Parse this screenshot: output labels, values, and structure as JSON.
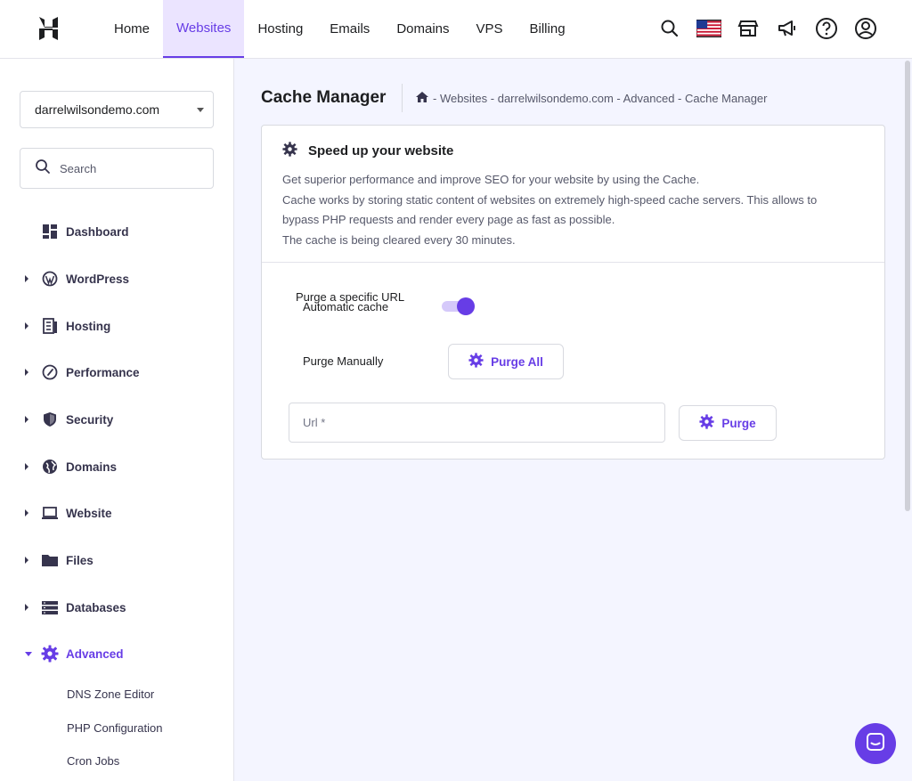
{
  "topbar": {
    "logo_icon": "hostinger-logo-icon",
    "nav": [
      {
        "label": "Home",
        "active": false
      },
      {
        "label": "Websites",
        "active": true
      },
      {
        "label": "Hosting",
        "active": false
      },
      {
        "label": "Emails",
        "active": false
      },
      {
        "label": "Domains",
        "active": false
      },
      {
        "label": "VPS",
        "active": false
      },
      {
        "label": "Billing",
        "active": false
      }
    ],
    "icons": [
      "search-icon",
      "us-flag-icon",
      "store-icon",
      "megaphone-icon",
      "help-icon",
      "account-icon"
    ]
  },
  "sidebar": {
    "domain_selected": "darrelwilsondemo.com",
    "search_placeholder": "Search",
    "items": [
      {
        "label": "Dashboard",
        "icon": "dashboard-icon",
        "expandable": false
      },
      {
        "label": "WordPress",
        "icon": "wordpress-icon",
        "expandable": true
      },
      {
        "label": "Hosting",
        "icon": "hosting-icon",
        "expandable": true
      },
      {
        "label": "Performance",
        "icon": "performance-icon",
        "expandable": true
      },
      {
        "label": "Security",
        "icon": "shield-icon",
        "expandable": true
      },
      {
        "label": "Domains",
        "icon": "globe-icon",
        "expandable": true
      },
      {
        "label": "Website",
        "icon": "laptop-icon",
        "expandable": true
      },
      {
        "label": "Files",
        "icon": "folder-icon",
        "expandable": true
      },
      {
        "label": "Databases",
        "icon": "database-icon",
        "expandable": true
      },
      {
        "label": "Advanced",
        "icon": "gear-icon",
        "expandable": true,
        "expanded": true
      }
    ],
    "sub_items": [
      "DNS Zone Editor",
      "PHP Configuration",
      "Cron Jobs"
    ]
  },
  "main": {
    "title": "Cache Manager",
    "breadcrumb": "- Websites - darrelwilsondemo.com - Advanced - Cache Manager",
    "card": {
      "heading": "Speed up your website",
      "description": [
        "Get superior performance and improve SEO for your website by using the Cache.",
        "Cache works by storing static content of websites on extremely high-speed cache servers. This allows to",
        "bypass PHP requests and render every page as fast as possible.",
        "The cache is being cleared every 30 minutes."
      ],
      "label_purge_specific": "Purge a specific URL",
      "label_automatic": "Automatic cache",
      "automatic_cache_on": true,
      "label_purge_manually": "Purge Manually",
      "purge_all_label": "Purge All",
      "url_placeholder": "Url *",
      "purge_label": "Purge"
    }
  },
  "colors": {
    "accent": "#673de6",
    "accent_light": "#ebe4ff",
    "background": "#f4f5ff"
  }
}
